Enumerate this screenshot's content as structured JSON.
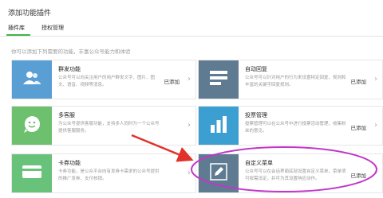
{
  "page_title": "添加功能插件",
  "tabs": [
    {
      "label": "插件库",
      "active": true
    },
    {
      "label": "授权管理",
      "active": false
    }
  ],
  "description": "你可以添加下列需要的功能，丰富公众号能力和体验",
  "plugins": [
    {
      "name": "群发功能",
      "text": "公众号可以向关注用户的用户群发文字、图片、图文、语音、视频等消息。",
      "status": "已添加",
      "icon": "users-icon"
    },
    {
      "name": "自动回复",
      "text": "公众号可以针对用户的行为来设置特定回复，规则和丰富的关键字回复规则。",
      "status": "已添加",
      "icon": "message-lines-icon"
    },
    {
      "name": "多客服",
      "text": "为公众号提供客服功能，支持多人同时为一个公众号提供客服服务。",
      "status": "",
      "icon": "smile-chat-icon"
    },
    {
      "name": "投票管理",
      "text": "投票管理可以在公众号中进行投票活动管理，收集粉丝的意见。",
      "status": "已添加",
      "icon": "bar-chart-icon"
    },
    {
      "name": "卡券功能",
      "text": "卡券功能，是公众平台向有发券卡需求的公众号提供的推广发券、支付核销。",
      "status": "",
      "icon": "card-icon"
    },
    {
      "name": "自定义菜单",
      "text": "公众号可以在会话界面底部设置自定义菜单，菜单项可按需设定，并可为其设置响应动作。",
      "status": "已添加",
      "icon": "edit-pen-icon"
    }
  ],
  "colors": {
    "accent_green": "#44b549",
    "annotation_arrow": "#e0312a",
    "annotation_ellipse": "#c236c9"
  }
}
